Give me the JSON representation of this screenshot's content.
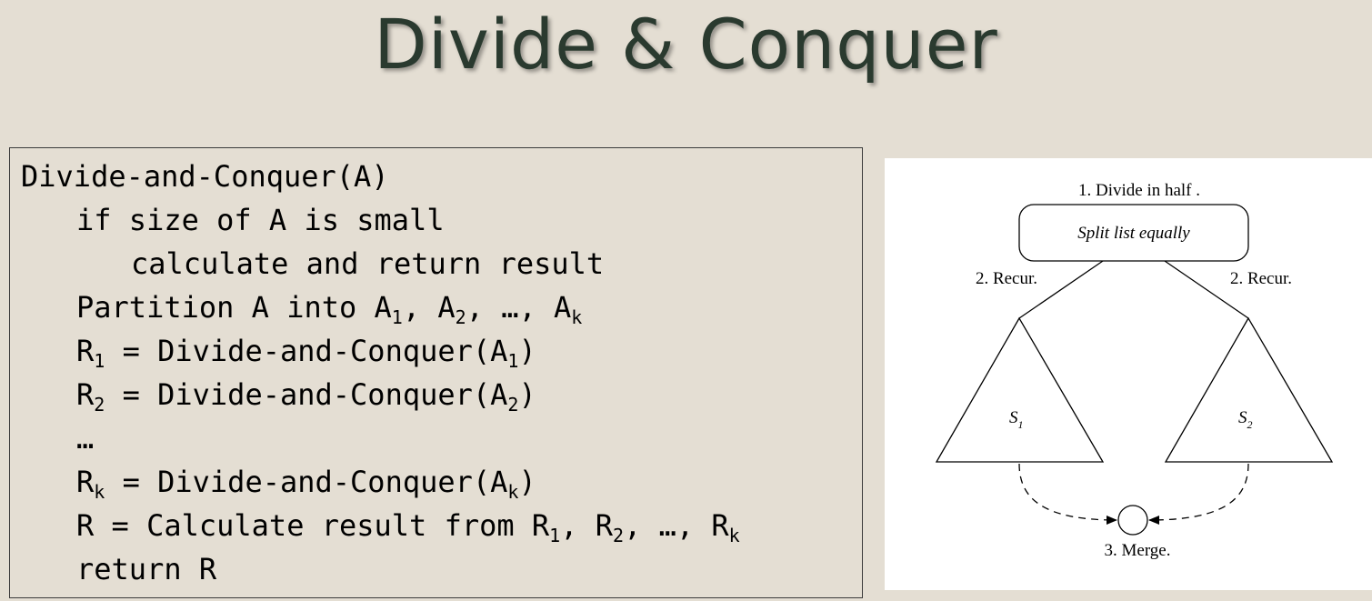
{
  "title": "Divide & Conquer",
  "code": {
    "lines": [
      {
        "parts": [
          {
            "t": "Divide-and-Conquer(A)"
          }
        ]
      },
      {
        "parts": [
          {
            "t": "if size of A is small"
          }
        ]
      },
      {
        "parts": [
          {
            "t": "calculate and return result"
          }
        ]
      },
      {
        "parts": [
          {
            "t": "Partition A into A"
          },
          {
            "sub": "1"
          },
          {
            "t": ", A"
          },
          {
            "sub": "2"
          },
          {
            "t": ", …, A"
          },
          {
            "sub": "k"
          }
        ]
      },
      {
        "parts": [
          {
            "t": "R"
          },
          {
            "sub": "1"
          },
          {
            "t": " = Divide-and-Conquer(A"
          },
          {
            "sub": "1"
          },
          {
            "t": ")"
          }
        ]
      },
      {
        "parts": [
          {
            "t": "R"
          },
          {
            "sub": "2"
          },
          {
            "t": " = Divide-and-Conquer(A"
          },
          {
            "sub": "2"
          },
          {
            "t": ")"
          }
        ]
      },
      {
        "parts": [
          {
            "t": "…"
          }
        ]
      },
      {
        "parts": [
          {
            "t": "R"
          },
          {
            "sub": "k"
          },
          {
            "t": " = Divide-and-Conquer(A"
          },
          {
            "sub": "k"
          },
          {
            "t": ")"
          }
        ]
      },
      {
        "parts": [
          {
            "t": "R = Calculate result from R"
          },
          {
            "sub": "1"
          },
          {
            "t": ", R"
          },
          {
            "sub": "2"
          },
          {
            "t": ", …, R"
          },
          {
            "sub": "k"
          }
        ]
      },
      {
        "parts": [
          {
            "t": "return R"
          }
        ]
      }
    ]
  },
  "figure": {
    "divide_label": "1. Divide in half .",
    "split_box_label": "Split list equally",
    "recur_left_label": "2. Recur.",
    "recur_right_label": "2. Recur.",
    "s1_label": "S",
    "s1_sub": "1",
    "s2_label": "S",
    "s2_sub": "2",
    "merge_label": "3. Merge."
  }
}
